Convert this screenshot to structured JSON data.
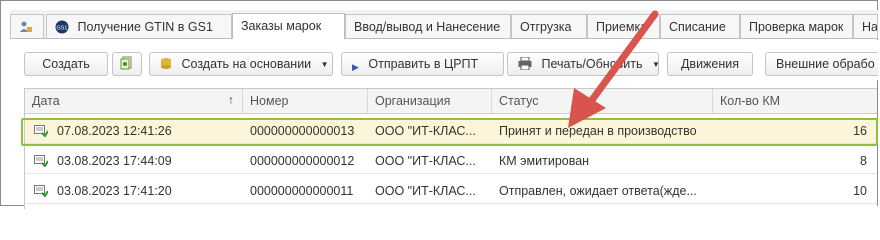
{
  "tabs": [
    {
      "label": ""
    },
    {
      "label": "Получение GTIN в GS1"
    },
    {
      "label": "Заказы марок"
    },
    {
      "label": "Ввод/вывод и Нанесение"
    },
    {
      "label": "Отгрузка"
    },
    {
      "label": "Приемка"
    },
    {
      "label": "Списание"
    },
    {
      "label": "Проверка марок"
    },
    {
      "label": "На"
    }
  ],
  "toolbar": {
    "create": "Создать",
    "create_based": "Создать на основании",
    "send": "Отправить в ЦРПТ",
    "print": "Печать/Обновить",
    "movements": "Движения",
    "external": "Внешние обрабо"
  },
  "table": {
    "columns": [
      "Дата",
      "Номер",
      "Организация",
      "Статус",
      "Кол-во КМ"
    ],
    "sort_indicator": "↑",
    "rows": [
      {
        "date": "07.08.2023 12:41:26",
        "number": "000000000000013",
        "org": "ООО \"ИТ-КЛАС...",
        "status": "Принят и передан в производство",
        "qty": "16"
      },
      {
        "date": "03.08.2023 17:44:09",
        "number": "000000000000012",
        "org": "ООО \"ИТ-КЛАС...",
        "status": "КМ эмитирован",
        "qty": "8"
      },
      {
        "date": "03.08.2023 17:41:20",
        "number": "000000000000011",
        "org": "ООО \"ИТ-КЛАС...",
        "status": "Отправлен, ожидает ответа(жде...",
        "qty": "10"
      }
    ]
  },
  "colors": {
    "highlight": "#8fc040",
    "arrow": "#d9534f",
    "selected_row": "#fdf5d9"
  }
}
